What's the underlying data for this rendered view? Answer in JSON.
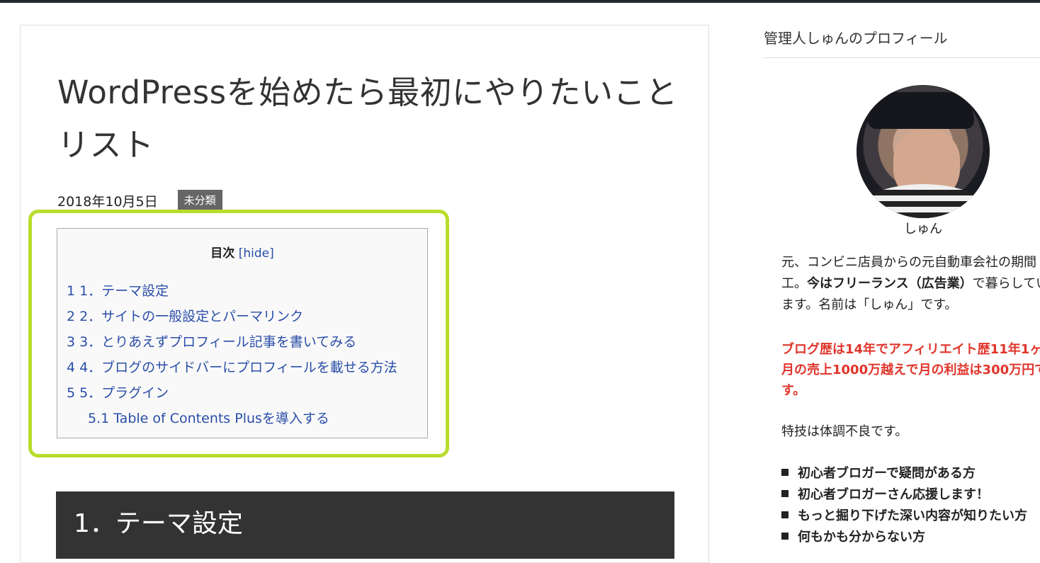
{
  "post": {
    "title": "WordPressを始めたら最初にやりたいことリスト",
    "date": "2018年10月5日",
    "category": "未分類"
  },
  "toc": {
    "title": "目次",
    "hide_label": "[hide]",
    "items": [
      {
        "num": "1",
        "label": "1．テーマ設定"
      },
      {
        "num": "2",
        "label": "2．サイトの一般設定とパーマリンク"
      },
      {
        "num": "3",
        "label": "3．とりあえずプロフィール記事を書いてみる"
      },
      {
        "num": "4",
        "label": "4．ブログのサイドバーにプロフィールを載せる方法"
      },
      {
        "num": "5",
        "label": "5．プラグイン"
      },
      {
        "num": "5.1",
        "label": "Table of Contents Plusを導入する"
      }
    ],
    "highlight_color": "#b8dd2d"
  },
  "section": {
    "title": "1．テーマ設定"
  },
  "sidebar": {
    "widget_title": "管理人しゅんのプロフィール",
    "profile_name": "しゅん",
    "bio_line1": "元、コンビニ店員からの元自動車会社の期間",
    "bio_line2_strong": "今はフリーランス（広告業）",
    "bio_line2_prefix": "工。",
    "bio_line2_suffix": "で暮らしてい",
    "bio_line3": "ます。名前は「しゅん」です。",
    "red_text": "ブログ歴は14年でアフィリエイト歴11年1ヶ月の売上1000万越えで月の利益は300万円です。",
    "skill_text": "特技は体調不良です。",
    "bullets": [
      "初心者ブロガーで疑問がある方",
      "初心者ブロガーさん応援します！",
      "もっと掘り下げた深い内容が知りたい方",
      "何もかも分からない方"
    ],
    "accent_red": "#e0352b"
  }
}
